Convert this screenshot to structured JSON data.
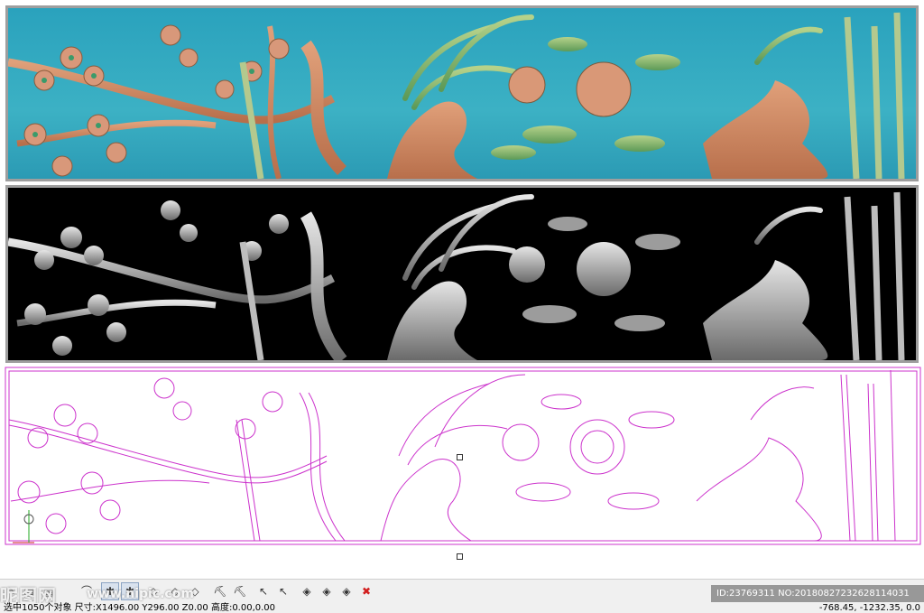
{
  "panels": {
    "color_relief": {
      "background": "#2aa2bd",
      "frame": "#9e9e9e"
    },
    "gray_relief": {
      "background": "#000000",
      "frame": "#9e9e9e"
    },
    "vector_lines": {
      "stroke": "#cc33cc",
      "background": "#ffffff"
    }
  },
  "toolbar": {
    "buttons": [
      {
        "icon": "pencil-x-icon"
      },
      {
        "icon": "layer-icon"
      },
      {
        "icon": "layer-icon"
      },
      {
        "icon": "curve-icon"
      },
      {
        "icon": "snap-icon"
      },
      {
        "icon": "snap-icon"
      },
      {
        "icon": "diamond-icon"
      },
      {
        "icon": "diamond-icon"
      },
      {
        "icon": "diamond-icon"
      },
      {
        "icon": "tool-icon"
      },
      {
        "icon": "tool-icon"
      },
      {
        "icon": "arrow-icon"
      },
      {
        "icon": "arrow-x-icon"
      },
      {
        "icon": "node-icon"
      },
      {
        "icon": "node-icon"
      },
      {
        "icon": "node-icon"
      },
      {
        "icon": "delete-icon"
      }
    ]
  },
  "status": {
    "left": "选中1050个对象  尺寸:X1496.00 Y296.00 Z0.00  高度:0.00,0.00",
    "right": "-768.45, -1232.35, 0.0"
  },
  "watermark": {
    "left": "昵图网",
    "site": "www.nipic.com",
    "id": "ID:23769311 NO:20180827232628114031"
  },
  "colors": {
    "accent_red": "#d21f1f",
    "line_magenta": "#cc33cc"
  }
}
